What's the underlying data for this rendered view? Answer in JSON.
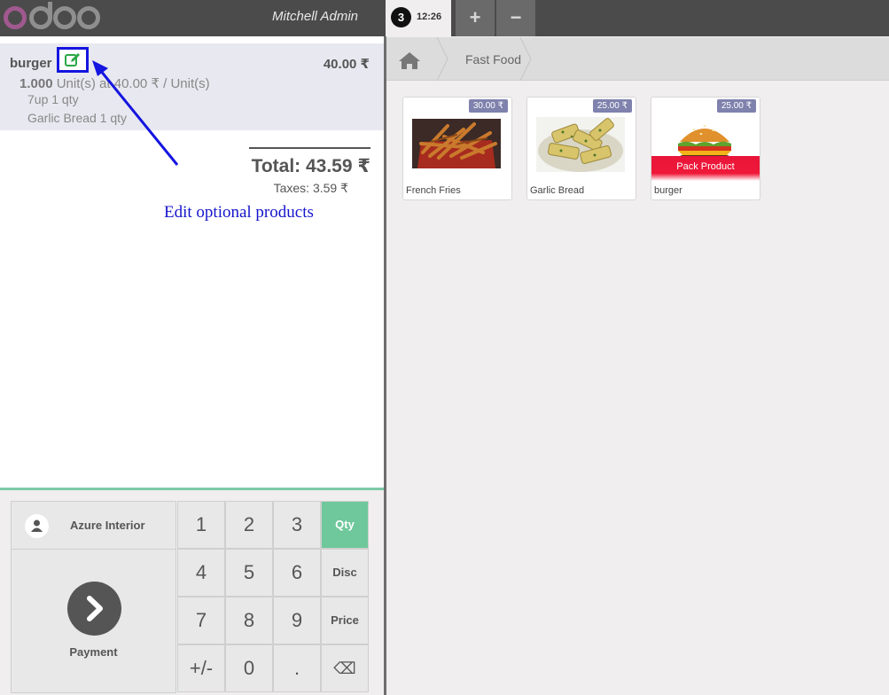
{
  "header": {
    "logo_text": "odoo",
    "cashier": "Mitchell Admin",
    "order_badge": "3",
    "order_time": "12:26",
    "add_label": "+",
    "remove_label": "−"
  },
  "order": {
    "line": {
      "name": "burger",
      "price": "40.00 ₹",
      "qty": "1.000",
      "unit_text": "Unit(s) at 40.00 ₹ / Unit(s)",
      "options": [
        "7up 1 qty",
        "Garlic Bread 1 qty"
      ]
    },
    "total": "Total: 43.59 ₹",
    "taxes": "Taxes: 3.59 ₹"
  },
  "annotation": "Edit optional products",
  "pad": {
    "customer": "Azure Interior",
    "payment": "Payment",
    "keys": [
      "1",
      "2",
      "3",
      "Qty",
      "4",
      "5",
      "6",
      "Disc",
      "7",
      "8",
      "9",
      "Price",
      "+/-",
      "0",
      ".",
      "⌫"
    ],
    "active_mode": "Qty"
  },
  "category": {
    "breadcrumb": "Fast Food"
  },
  "products": [
    {
      "name": "French Fries",
      "price": "30.00 ₹"
    },
    {
      "name": "Garlic Bread",
      "price": "25.00 ₹"
    },
    {
      "name": "burger",
      "price": "25.00 ₹",
      "ribbon": "Pack Product"
    }
  ],
  "colors": {
    "header_bg": "#4b4b4b",
    "active_key": "#6ec89b",
    "price_tag": "#7f82ad",
    "pack_ribbon": "#f01838",
    "annotation": "#1515cc"
  }
}
